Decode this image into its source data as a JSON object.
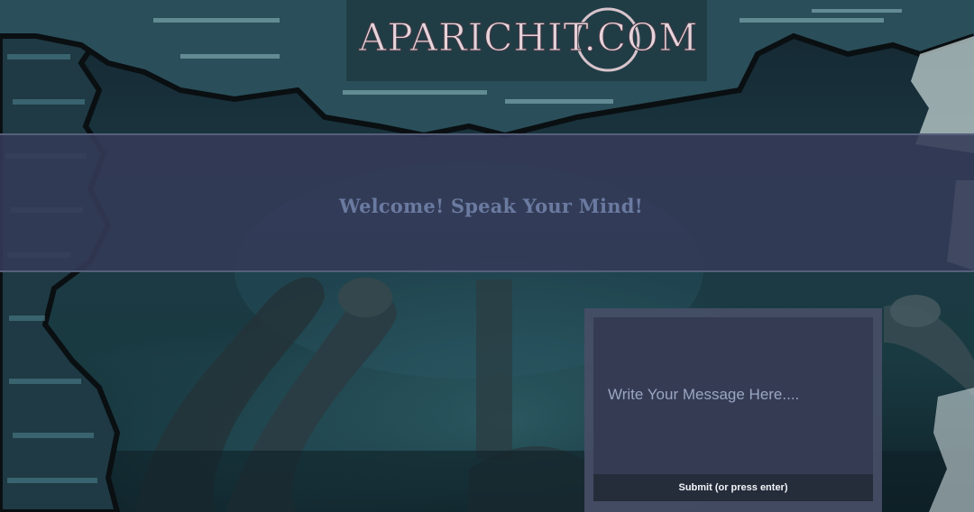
{
  "header": {
    "logo_text": "APARICHIT.COM"
  },
  "welcome": {
    "heading": "Welcome! Speak Your Mind!"
  },
  "message_form": {
    "placeholder": "Write Your Message Here....",
    "value": "",
    "submit_label": "Submit (or press enter)"
  },
  "colors": {
    "band": "#343a58",
    "heading": "#6a7aa0",
    "panel": "#464e66",
    "button": "#252c3a"
  }
}
